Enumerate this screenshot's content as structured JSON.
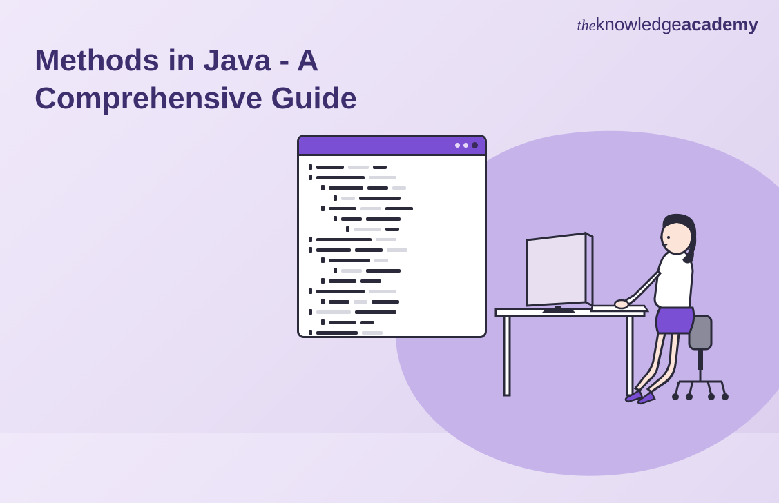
{
  "logo": {
    "the": "the",
    "kn": "knowledge",
    "ac": "academy"
  },
  "title": "Methods in Java - A Comprehensive Guide"
}
